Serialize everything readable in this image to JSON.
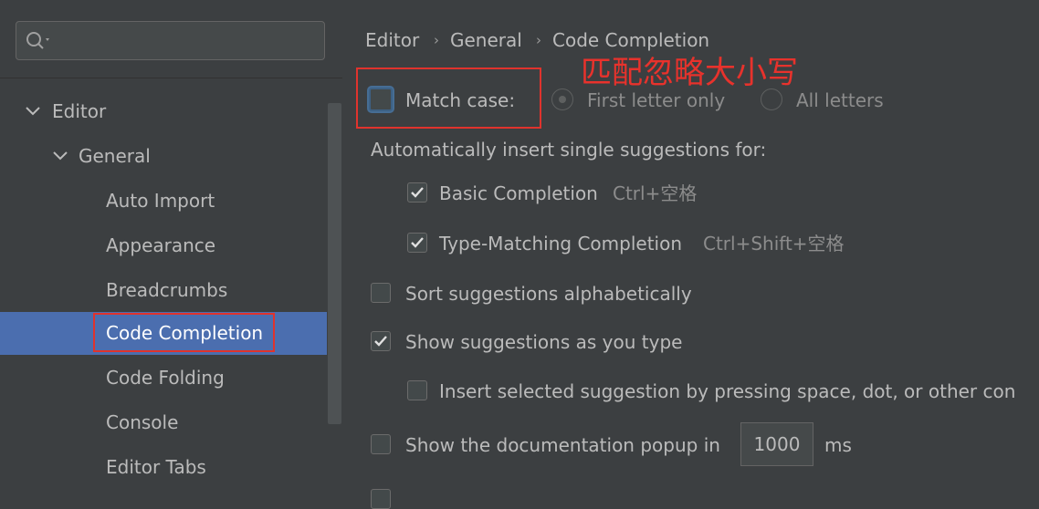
{
  "search": {
    "placeholder": ""
  },
  "sidebar": {
    "items": [
      {
        "label": "Editor",
        "expandable": true
      },
      {
        "label": "General",
        "expandable": true
      },
      {
        "label": "Auto Import"
      },
      {
        "label": "Appearance"
      },
      {
        "label": "Breadcrumbs"
      },
      {
        "label": "Code Completion",
        "selected": true
      },
      {
        "label": "Code Folding"
      },
      {
        "label": "Console"
      },
      {
        "label": "Editor Tabs"
      }
    ]
  },
  "breadcrumb": [
    "Editor",
    "General",
    "Code Completion"
  ],
  "annotation": {
    "text": "匹配忽略大小写"
  },
  "settings": {
    "match_case": {
      "label": "Match case:",
      "checked": false
    },
    "match_case_options": [
      {
        "label": "First letter only",
        "selected": true
      },
      {
        "label": "All letters",
        "selected": false
      }
    ],
    "auto_insert_heading": "Automatically insert single suggestions for:",
    "basic_completion": {
      "label": "Basic Completion",
      "shortcut": "Ctrl+空格",
      "checked": true
    },
    "type_matching": {
      "label": "Type-Matching Completion",
      "shortcut": "Ctrl+Shift+空格",
      "checked": true
    },
    "sort_alpha": {
      "label": "Sort suggestions alphabetically",
      "checked": false
    },
    "show_as_type": {
      "label": "Show suggestions as you type",
      "checked": true
    },
    "insert_selected": {
      "label": "Insert selected suggestion by pressing space, dot, or other con",
      "checked": false
    },
    "doc_popup": {
      "label": "Show the documentation popup in",
      "value": "1000",
      "unit": "ms",
      "checked": false
    }
  },
  "colors": {
    "background": "#3c3f41",
    "selection": "#4b6eaf",
    "annotation_red": "#e0332d",
    "text": "#bbbbbb"
  }
}
